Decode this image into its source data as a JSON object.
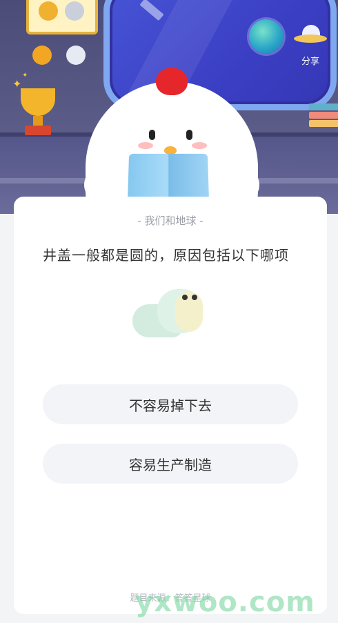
{
  "header": {
    "share_label": "分享",
    "icons": [
      "badge-frame-icon",
      "medal-icon",
      "trophy-icon",
      "globe-icon",
      "ufo-share-icon",
      "chicken-mascot"
    ]
  },
  "card": {
    "subtitle": "- 我们和地球 -",
    "question": "井盖一般都是圆的，原因包括以下哪项",
    "options": [
      {
        "label": "不容易掉下去"
      },
      {
        "label": "容易生产制造"
      }
    ],
    "footer": "题目来源：答答星球"
  },
  "watermark": {
    "text": "yxwoo.com"
  },
  "colors": {
    "scene_bg": "#4b4c78",
    "window": "#4754d6",
    "card_bg": "#ffffff",
    "option_bg": "#f2f4f7",
    "comb": "#e5262a",
    "watermark": "#6ed296"
  }
}
